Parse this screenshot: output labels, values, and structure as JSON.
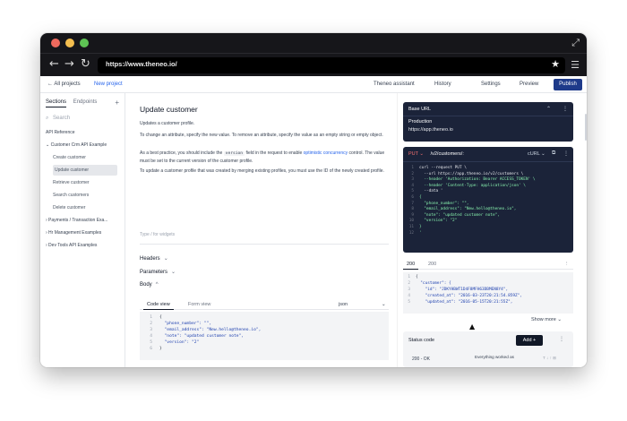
{
  "browser": {
    "url": "https://www.theneo.io/",
    "back": "←",
    "forward": "→",
    "reload": "↻",
    "expand": "⤢",
    "star": "★",
    "menu": "☰"
  },
  "appbar": {
    "back_label": "← All projects",
    "new_project": "New project",
    "assistant": "Theneo assistant",
    "history": "History",
    "settings": "Settings",
    "preview": "Preview",
    "publish": "Publish"
  },
  "sidebar": {
    "tab_sections": "Sections",
    "tab_endpoints": "Endpoints",
    "add": "+",
    "search_placeholder": "Search",
    "items": [
      {
        "label": "API Reference"
      },
      {
        "label": "⌄ Customer Crm API Example"
      },
      {
        "label": "Create customer"
      },
      {
        "label": "Update customer"
      },
      {
        "label": "Retrieve customer"
      },
      {
        "label": "Search customers"
      },
      {
        "label": "Delete customer"
      },
      {
        "label": "› Payments / Transaction Exa..."
      },
      {
        "label": "› Hr Management Examples"
      },
      {
        "label": "› Dev Tools API Examples"
      }
    ]
  },
  "content": {
    "title": "Update customer",
    "p1": "Updates a customer profile.",
    "p2": "To change an attribute, specify the new value. To remove an attribute, specify the value as an empty string or empty object.",
    "p3_a": "As a best practice, you should include the",
    "p3_code": "version",
    "p3_b": "field in the request to enable",
    "p3_link": "optimistic concurrency",
    "p3_c": "control. The value must be set to the current version of the customer profile.",
    "p4": "To update a customer profile that was created by merging existing profiles, you must use the ID of the newly created profile.",
    "placeholder": "Type / for widgets",
    "headers": "Headers",
    "parameters": "Parameters",
    "body": "Body",
    "caret_down": "⌄",
    "caret_up": "^",
    "tab_code": "Code view",
    "tab_form": "Form view",
    "format": "json",
    "format_caret": "⌄",
    "code_lines": [
      {
        "n": "1",
        "t": "{"
      },
      {
        "n": "2",
        "t": "  \"phone_number\": \"\","
      },
      {
        "n": "3",
        "t": "  \"email_address\": \"New.hello@theneo.io\","
      },
      {
        "n": "4",
        "t": "  \"note\": \"updated customer note\","
      },
      {
        "n": "5",
        "t": "  \"version\": \"2\""
      },
      {
        "n": "6",
        "t": "}"
      }
    ]
  },
  "right": {
    "base_url_title": "Base URL",
    "base_url_chevron": "⌃",
    "base_url_more": "⋮",
    "production": "Production",
    "production_url": "https://app.theneo.io",
    "method": "PUT ⌄",
    "endpoint": "/v2/customers/:",
    "lang": "cURL ⌄",
    "copy": "⧉",
    "more": "⋮",
    "request_lines": [
      {
        "n": "1",
        "t": "curl --request PUT \\"
      },
      {
        "n": "2",
        "t": "  --url https://app.theneo.io/v2/customers \\"
      },
      {
        "n": "3",
        "t": "  --header 'Authorization: Bearer ACCESS_TOKEN' \\"
      },
      {
        "n": "4",
        "t": "  --header 'Content-Type: application/json' \\"
      },
      {
        "n": "5",
        "t": "  --data '"
      },
      {
        "n": "6",
        "t": "{"
      },
      {
        "n": "7",
        "t": "  \"phone_number\": \"\","
      },
      {
        "n": "8",
        "t": "  \"email_address\": \"New.hello@theneo.io\","
      },
      {
        "n": "9",
        "t": "  \"note\": \"updated customer note\","
      },
      {
        "n": "10",
        "t": "  \"version\": \"2\""
      },
      {
        "n": "11",
        "t": "}"
      },
      {
        "n": "12",
        "t": "'"
      }
    ],
    "resp_tab_200": "200",
    "resp_tab_200b": "200",
    "resp_more": "⋮",
    "response_lines": [
      {
        "n": "1",
        "t": "{"
      },
      {
        "n": "2",
        "t": "  \"customer\": {"
      },
      {
        "n": "3",
        "t": "    \"id\": \"JDKYHBWT1D4F8MFH63DBMEN8Y4\","
      },
      {
        "n": "4",
        "t": "    \"created_at\": \"2016-03-23T20:21:54.859Z\","
      },
      {
        "n": "5",
        "t": "    \"updated_at\": \"2016-05-15T20:21:55Z\","
      }
    ],
    "show_more": "Show more ⌄",
    "cursor": "▲",
    "status_code": "Status code",
    "add": "Add +",
    "status_more": "⋮",
    "status_200": "200 - OK",
    "status_desc": "Everything worked as",
    "status_tools": "T  ↓  ↑  ⊞"
  }
}
